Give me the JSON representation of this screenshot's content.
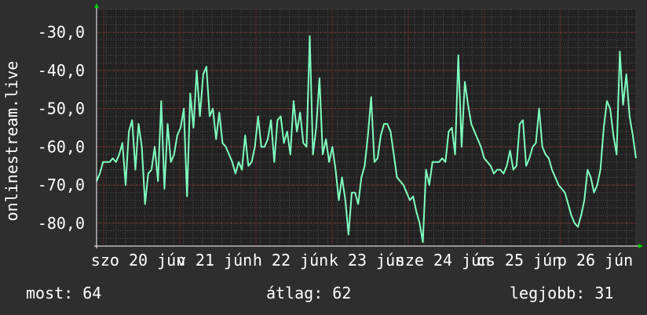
{
  "chart_data": {
    "type": "line",
    "ylabel": "onlinestream.live",
    "ylim": [
      -86,
      -24
    ],
    "yticks": [
      -80,
      -70,
      -60,
      -50,
      -40,
      -30
    ],
    "ytick_labels": [
      "-80,0",
      "-70,0",
      "-60,0",
      "-50,0",
      "-40,0",
      "-30,0"
    ],
    "x_tick_labels": [
      "szo 20 jún",
      "v 21 jún",
      "h 22 jún",
      "k 23 jún",
      "sze 24 jún",
      "cs 25 jún",
      "p 26 jún"
    ],
    "series": [
      {
        "color": "#7fffbf",
        "x": [
          0,
          1,
          2,
          3,
          4,
          5,
          6,
          7,
          8,
          9,
          10,
          11,
          12,
          13,
          14,
          15,
          16,
          17,
          18,
          19,
          20,
          21,
          22,
          23,
          24,
          25,
          26,
          27,
          28,
          29,
          30,
          31,
          32,
          33,
          34,
          35,
          36,
          37,
          38,
          39,
          40,
          41,
          42,
          43,
          44,
          45,
          46,
          47,
          48,
          49,
          50,
          51,
          52,
          53,
          54,
          55,
          56,
          57,
          58,
          59,
          60,
          61,
          62,
          63,
          64,
          65,
          66,
          67,
          68,
          69,
          70,
          71,
          72,
          73,
          74,
          75,
          76,
          77,
          78,
          79,
          80,
          81,
          82,
          83,
          84,
          85,
          86,
          87,
          88,
          89,
          90,
          91,
          92,
          93,
          94,
          95,
          96,
          97,
          98,
          99,
          100,
          101,
          102,
          103,
          104,
          105,
          106,
          107,
          108,
          109,
          110,
          111,
          112,
          113,
          114,
          115,
          116,
          117,
          118,
          119,
          120,
          121,
          122,
          123,
          124,
          125,
          126,
          127,
          128,
          129,
          130,
          131,
          132,
          133,
          134,
          135,
          136,
          137,
          138,
          139,
          140,
          141,
          142,
          143,
          144,
          145,
          146,
          147,
          148,
          149,
          150,
          151,
          152,
          153,
          154,
          155,
          156,
          157,
          158,
          159,
          160,
          161,
          162,
          163,
          164,
          165,
          166,
          167
        ],
        "values": [
          -69,
          -67,
          -64,
          -64,
          -64,
          -63,
          -64,
          -62,
          -59,
          -70,
          -56,
          -53,
          -66,
          -54,
          -60,
          -75,
          -67,
          -66,
          -60,
          -69,
          -48,
          -71,
          -54,
          -64,
          -62,
          -57,
          -55,
          -50,
          -73,
          -46,
          -55,
          -40,
          -52,
          -41,
          -39,
          -52,
          -50,
          -58,
          -51,
          -59,
          -60,
          -62,
          -64,
          -67,
          -64,
          -66,
          -57,
          -65,
          -64,
          -60,
          -52,
          -60,
          -60,
          -58,
          -53,
          -64,
          -53,
          -52,
          -59,
          -56,
          -62,
          -48,
          -56,
          -51,
          -59,
          -60,
          -31,
          -62,
          -55,
          -42,
          -62,
          -58,
          -64,
          -60,
          -66,
          -74,
          -68,
          -74,
          -83,
          -72,
          -72,
          -75,
          -68,
          -65,
          -57,
          -47,
          -64,
          -63,
          -57,
          -54,
          -54,
          -56,
          -62,
          -68,
          -69,
          -70,
          -72,
          -74,
          -73,
          -77,
          -80,
          -85,
          -66,
          -70,
          -64,
          -64,
          -64,
          -63,
          -64,
          -56,
          -55,
          -62,
          -36,
          -60,
          -43,
          -49,
          -54,
          -56,
          -58,
          -60,
          -63,
          -64,
          -65,
          -67,
          -66,
          -66,
          -67,
          -65,
          -61,
          -66,
          -65,
          -54,
          -53,
          -65,
          -63,
          -60,
          -59,
          -50,
          -60,
          -62,
          -63,
          -66,
          -68,
          -70,
          -71,
          -72,
          -75,
          -78,
          -80,
          -81,
          -78,
          -74,
          -66,
          -68,
          -72,
          -70,
          -66,
          -55,
          -48,
          -50,
          -57,
          -62,
          -35,
          -49,
          -41,
          -52,
          -57,
          -63
        ],
        "note_unused": ""
      }
    ],
    "xlim": [
      0,
      167
    ]
  },
  "footer": {
    "now_label": "most:",
    "now_value": "64",
    "avg_label": "átlag:",
    "avg_value": "62",
    "best_label": "legjobb:",
    "best_value": "31"
  },
  "colors": {
    "background": "#2e2e2e",
    "plot_background": "#222222",
    "line": "#7fffbf",
    "grid_major": "#8a2d2d",
    "grid_minor": "#555555",
    "text": "#ffffff",
    "axis_arrow": "#00cc00"
  }
}
